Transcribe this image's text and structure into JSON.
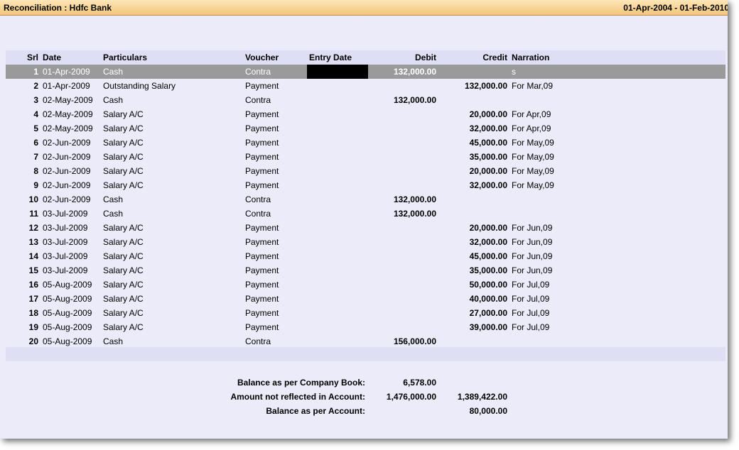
{
  "window": {
    "title": "Reconciliation : Hdfc Bank",
    "period": "01-Apr-2004 - 01-Feb-2010"
  },
  "columns": {
    "srl": "Srl",
    "date": "Date",
    "particulars": "Particulars",
    "voucher": "Voucher",
    "entry_date": "Entry Date",
    "debit": "Debit",
    "credit": "Credit",
    "narration": "Narration"
  },
  "rows": [
    {
      "srl": "1",
      "date": "01-Apr-2009",
      "particulars": "Cash",
      "voucher": "Contra",
      "entry_date": "",
      "debit": "132,000.00",
      "credit": "",
      "narration": "s"
    },
    {
      "srl": "2",
      "date": "01-Apr-2009",
      "particulars": "Outstanding Salary",
      "voucher": "Payment",
      "entry_date": "",
      "debit": "",
      "credit": "132,000.00",
      "narration": "For Mar,09"
    },
    {
      "srl": "3",
      "date": "02-May-2009",
      "particulars": "Cash",
      "voucher": "Contra",
      "entry_date": "",
      "debit": "132,000.00",
      "credit": "",
      "narration": ""
    },
    {
      "srl": "4",
      "date": "02-May-2009",
      "particulars": "Salary A/C",
      "voucher": "Payment",
      "entry_date": "",
      "debit": "",
      "credit": "20,000.00",
      "narration": "For Apr,09"
    },
    {
      "srl": "5",
      "date": "02-May-2009",
      "particulars": "Salary A/C",
      "voucher": "Payment",
      "entry_date": "",
      "debit": "",
      "credit": "32,000.00",
      "narration": "For Apr,09"
    },
    {
      "srl": "6",
      "date": "02-Jun-2009",
      "particulars": "Salary A/C",
      "voucher": "Payment",
      "entry_date": "",
      "debit": "",
      "credit": "45,000.00",
      "narration": "For May,09"
    },
    {
      "srl": "7",
      "date": "02-Jun-2009",
      "particulars": "Salary A/C",
      "voucher": "Payment",
      "entry_date": "",
      "debit": "",
      "credit": "35,000.00",
      "narration": "For May,09"
    },
    {
      "srl": "8",
      "date": "02-Jun-2009",
      "particulars": "Salary A/C",
      "voucher": "Payment",
      "entry_date": "",
      "debit": "",
      "credit": "20,000.00",
      "narration": "For May,09"
    },
    {
      "srl": "9",
      "date": "02-Jun-2009",
      "particulars": "Salary A/C",
      "voucher": "Payment",
      "entry_date": "",
      "debit": "",
      "credit": "32,000.00",
      "narration": "For May,09"
    },
    {
      "srl": "10",
      "date": "02-Jun-2009",
      "particulars": "Cash",
      "voucher": "Contra",
      "entry_date": "",
      "debit": "132,000.00",
      "credit": "",
      "narration": ""
    },
    {
      "srl": "11",
      "date": "03-Jul-2009",
      "particulars": "Cash",
      "voucher": "Contra",
      "entry_date": "",
      "debit": "132,000.00",
      "credit": "",
      "narration": ""
    },
    {
      "srl": "12",
      "date": "03-Jul-2009",
      "particulars": "Salary A/C",
      "voucher": "Payment",
      "entry_date": "",
      "debit": "",
      "credit": "20,000.00",
      "narration": "For Jun,09"
    },
    {
      "srl": "13",
      "date": "03-Jul-2009",
      "particulars": "Salary A/C",
      "voucher": "Payment",
      "entry_date": "",
      "debit": "",
      "credit": "32,000.00",
      "narration": "For Jun,09"
    },
    {
      "srl": "14",
      "date": "03-Jul-2009",
      "particulars": "Salary A/C",
      "voucher": "Payment",
      "entry_date": "",
      "debit": "",
      "credit": "45,000.00",
      "narration": "For Jun,09"
    },
    {
      "srl": "15",
      "date": "03-Jul-2009",
      "particulars": "Salary A/C",
      "voucher": "Payment",
      "entry_date": "",
      "debit": "",
      "credit": "35,000.00",
      "narration": "For Jun,09"
    },
    {
      "srl": "16",
      "date": "05-Aug-2009",
      "particulars": "Salary A/C",
      "voucher": "Payment",
      "entry_date": "",
      "debit": "",
      "credit": "50,000.00",
      "narration": "For Jul,09"
    },
    {
      "srl": "17",
      "date": "05-Aug-2009",
      "particulars": "Salary A/C",
      "voucher": "Payment",
      "entry_date": "",
      "debit": "",
      "credit": "40,000.00",
      "narration": "For Jul,09"
    },
    {
      "srl": "18",
      "date": "05-Aug-2009",
      "particulars": "Salary A/C",
      "voucher": "Payment",
      "entry_date": "",
      "debit": "",
      "credit": "27,000.00",
      "narration": "For Jul,09"
    },
    {
      "srl": "19",
      "date": "05-Aug-2009",
      "particulars": "Salary A/C",
      "voucher": "Payment",
      "entry_date": "",
      "debit": "",
      "credit": "39,000.00",
      "narration": "For Jul,09"
    },
    {
      "srl": "20",
      "date": "05-Aug-2009",
      "particulars": "Cash",
      "voucher": "Contra",
      "entry_date": "",
      "debit": "156,000.00",
      "credit": "",
      "narration": ""
    }
  ],
  "summary": [
    {
      "label": "Balance as per Company Book:",
      "debit": "6,578.00",
      "credit": ""
    },
    {
      "label": "Amount not reflected in Account:",
      "debit": "1,476,000.00",
      "credit": "1,389,422.00"
    },
    {
      "label": "Balance as per Account:",
      "debit": "",
      "credit": "80,000.00"
    }
  ],
  "colors": {
    "window_bg": "#ebebf9",
    "titlebar": "#f3c67b",
    "selected_row": "#9a9a9a",
    "header_row": "#dedff5"
  }
}
